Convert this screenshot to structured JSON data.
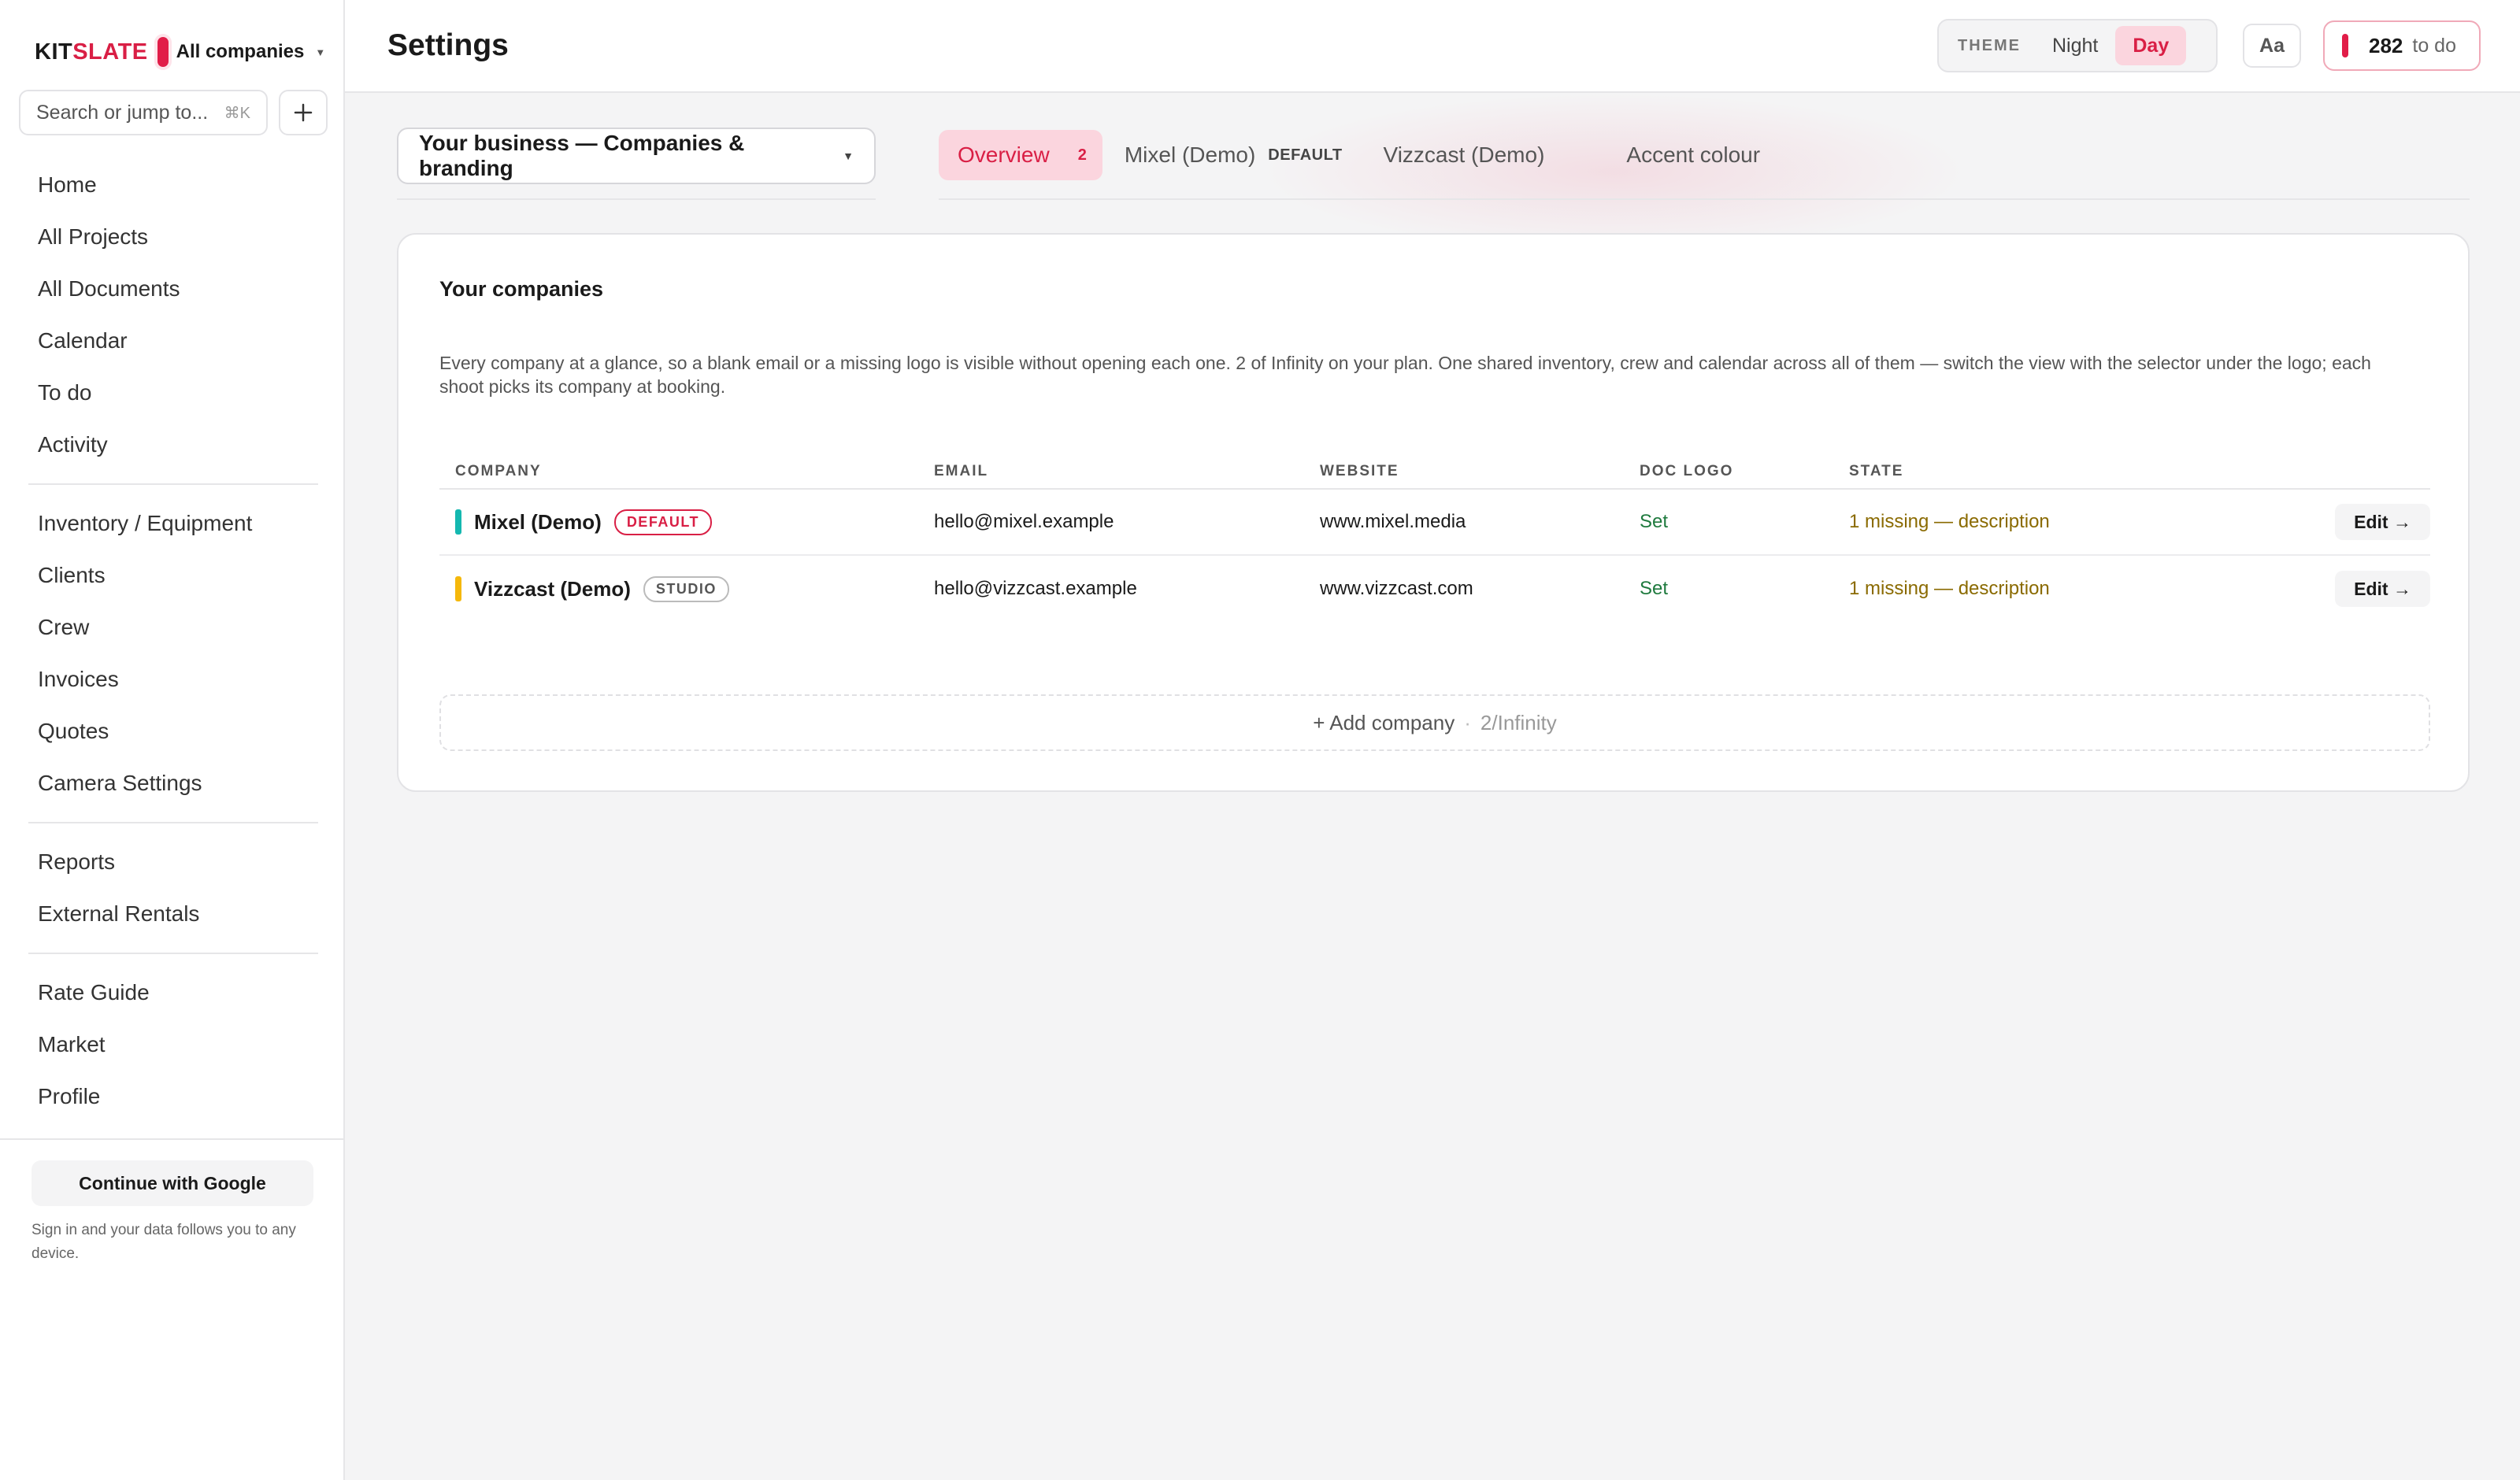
{
  "brand": {
    "logo_part1": "KIT",
    "logo_part2": "SLATE",
    "company_switch": "All companies",
    "accent_color": "#e11d48"
  },
  "search": {
    "placeholder": "Search or jump to...",
    "shortcut": "⌘K"
  },
  "sidebar": {
    "group1": [
      "Home",
      "All Projects",
      "All Documents",
      "Calendar",
      "To do",
      "Activity"
    ],
    "group2": [
      "Inventory / Equipment",
      "Clients",
      "Crew",
      "Invoices",
      "Quotes",
      "Camera Settings"
    ],
    "group3": [
      "Reports",
      "External Rentals"
    ],
    "group4": [
      "Rate Guide",
      "Market",
      "Profile"
    ],
    "google_button": "Continue with Google",
    "google_note": "Sign in and your data follows you to any device."
  },
  "header": {
    "title": "Settings",
    "theme_label": "THEME",
    "theme_night": "Night",
    "theme_day": "Day",
    "theme_selected": "Day",
    "font_button": "Aa",
    "todo_count": "282",
    "todo_label": "to do"
  },
  "section_select": {
    "value": "Your business — Companies & branding"
  },
  "tabs": {
    "overview": "Overview",
    "overview_badge": "2",
    "mixel": "Mixel (Demo)",
    "mixel_tag": "DEFAULT",
    "vizzcast": "Vizzcast (Demo)",
    "accent": "Accent colour"
  },
  "card": {
    "title": "Your companies",
    "description": "Every company at a glance, so a blank email or a missing logo is visible without opening each one. 2 of Infinity on your plan. One shared inventory, crew and calendar across all of them — switch the view with the selector under the logo; each shoot picks its company at booking."
  },
  "table": {
    "headers": {
      "company": "COMPANY",
      "email": "EMAIL",
      "website": "WEBSITE",
      "doc_logo": "DOC LOGO",
      "state": "STATE"
    },
    "rows": [
      {
        "name": "Mixel (Demo)",
        "tag": "DEFAULT",
        "color": "#14b8b0",
        "email": "hello@mixel.example",
        "website": "www.mixel.media",
        "doc_logo": "Set",
        "state": "1 missing — description",
        "action": "Edit →"
      },
      {
        "name": "Vizzcast (Demo)",
        "tag": "STUDIO",
        "color": "#f5b80b",
        "email": "hello@vizzcast.example",
        "website": "www.vizzcast.com",
        "doc_logo": "Set",
        "state": "1 missing — description",
        "action": "Edit →"
      }
    ]
  },
  "add_company": {
    "label": "+ Add company",
    "limit": "2/Infinity"
  }
}
